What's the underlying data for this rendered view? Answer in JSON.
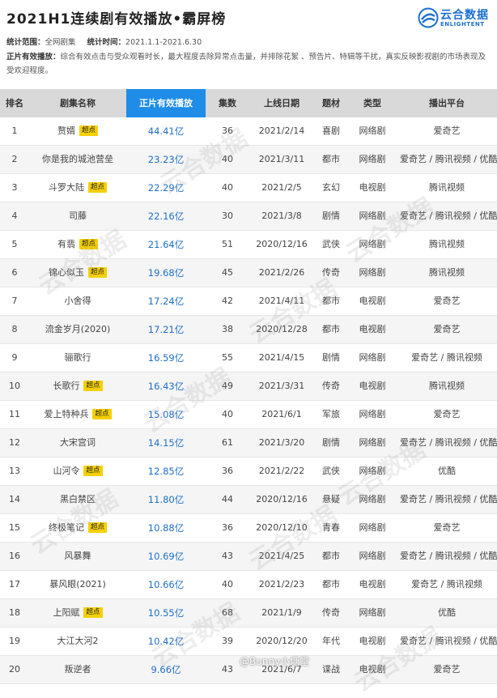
{
  "title": "2021H1连续剧有效播放•霸屏榜",
  "logo": {
    "name_cn": "云合数据",
    "name_en": "ENLIGHTENT"
  },
  "meta": {
    "scope_label": "统计范围：",
    "scope_value": "全网剧集",
    "time_label": "统计时间：",
    "time_value": "2021.1.1-2021.6.30"
  },
  "note": {
    "label": "正片有效播放：",
    "text": "综合有效点击与受众观看时长，最大程度去除异常点击量，并排除花絮 、预告片、特辑等干扰，真实反映影视剧的市场表现及受欢迎程度。"
  },
  "columns": {
    "rank": "排名",
    "name": "剧集名称",
    "plays": "正片有效播放",
    "episodes": "集数",
    "date": "上线日期",
    "genre": "题材",
    "type": "类型",
    "platform": "播出平台"
  },
  "badge_text": "超点",
  "rows": [
    {
      "rank": "1",
      "name": "赘婿",
      "badge": true,
      "plays": "44.41亿",
      "episodes": "36",
      "date": "2021/2/14",
      "genre": "喜剧",
      "type": "网络剧",
      "platform": "爱奇艺"
    },
    {
      "rank": "2",
      "name": "你是我的城池营垒",
      "badge": false,
      "plays": "23.23亿",
      "episodes": "40",
      "date": "2021/3/11",
      "genre": "都市",
      "type": "网络剧",
      "platform": "爱奇艺 / 腾讯视频 / 优酷"
    },
    {
      "rank": "3",
      "name": "斗罗大陆",
      "badge": true,
      "plays": "22.29亿",
      "episodes": "40",
      "date": "2021/2/5",
      "genre": "玄幻",
      "type": "电视剧",
      "platform": "腾讯视频"
    },
    {
      "rank": "4",
      "name": "司藤",
      "badge": false,
      "plays": "22.16亿",
      "episodes": "30",
      "date": "2021/3/8",
      "genre": "剧情",
      "type": "网络剧",
      "platform": "爱奇艺 / 腾讯视频 / 优酷"
    },
    {
      "rank": "5",
      "name": "有翡",
      "badge": true,
      "plays": "21.64亿",
      "episodes": "51",
      "date": "2020/12/16",
      "genre": "武侠",
      "type": "网络剧",
      "platform": "腾讯视频"
    },
    {
      "rank": "6",
      "name": "锦心似玉",
      "badge": true,
      "plays": "19.68亿",
      "episodes": "45",
      "date": "2021/2/26",
      "genre": "传奇",
      "type": "网络剧",
      "platform": "腾讯视频"
    },
    {
      "rank": "7",
      "name": "小舍得",
      "badge": false,
      "plays": "17.24亿",
      "episodes": "42",
      "date": "2021/4/11",
      "genre": "都市",
      "type": "电视剧",
      "platform": "爱奇艺"
    },
    {
      "rank": "8",
      "name": "流金岁月(2020)",
      "badge": false,
      "plays": "17.21亿",
      "episodes": "38",
      "date": "2020/12/28",
      "genre": "都市",
      "type": "电视剧",
      "platform": "爱奇艺"
    },
    {
      "rank": "9",
      "name": "骊歌行",
      "badge": false,
      "plays": "16.59亿",
      "episodes": "55",
      "date": "2021/4/15",
      "genre": "剧情",
      "type": "网络剧",
      "platform": "爱奇艺 / 腾讯视频"
    },
    {
      "rank": "10",
      "name": "长歌行",
      "badge": true,
      "plays": "16.43亿",
      "episodes": "49",
      "date": "2021/3/31",
      "genre": "传奇",
      "type": "电视剧",
      "platform": "腾讯视频"
    },
    {
      "rank": "11",
      "name": "爱上特种兵",
      "badge": true,
      "plays": "15.08亿",
      "episodes": "40",
      "date": "2021/6/1",
      "genre": "军旅",
      "type": "网络剧",
      "platform": "爱奇艺"
    },
    {
      "rank": "12",
      "name": "大宋宫词",
      "badge": false,
      "plays": "14.15亿",
      "episodes": "61",
      "date": "2021/3/20",
      "genre": "剧情",
      "type": "网络剧",
      "platform": "爱奇艺 / 腾讯视频 / 优酷"
    },
    {
      "rank": "13",
      "name": "山河令",
      "badge": true,
      "plays": "12.85亿",
      "episodes": "36",
      "date": "2021/2/22",
      "genre": "武侠",
      "type": "网络剧",
      "platform": "优酷"
    },
    {
      "rank": "14",
      "name": "黑白禁区",
      "badge": false,
      "plays": "11.80亿",
      "episodes": "44",
      "date": "2020/12/16",
      "genre": "悬疑",
      "type": "网络剧",
      "platform": "爱奇艺 / 腾讯视频 / 优酷"
    },
    {
      "rank": "15",
      "name": "终极笔记",
      "badge": true,
      "plays": "10.88亿",
      "episodes": "36",
      "date": "2020/12/10",
      "genre": "青春",
      "type": "网络剧",
      "platform": "爱奇艺"
    },
    {
      "rank": "16",
      "name": "风暴舞",
      "badge": false,
      "plays": "10.69亿",
      "episodes": "43",
      "date": "2021/4/25",
      "genre": "都市",
      "type": "网络剧",
      "platform": "爱奇艺 / 腾讯视频 / 优酷"
    },
    {
      "rank": "17",
      "name": "暴风眼(2021)",
      "badge": false,
      "plays": "10.66亿",
      "episodes": "40",
      "date": "2021/2/23",
      "genre": "都市",
      "type": "电视剧",
      "platform": "爱奇艺 / 腾讯视频"
    },
    {
      "rank": "18",
      "name": "上阳赋",
      "badge": true,
      "plays": "10.55亿",
      "episodes": "68",
      "date": "2021/1/9",
      "genre": "传奇",
      "type": "网络剧",
      "platform": "优酷"
    },
    {
      "rank": "19",
      "name": "大江大河2",
      "badge": false,
      "plays": "10.42亿",
      "episodes": "39",
      "date": "2020/12/20",
      "genre": "年代",
      "type": "电视剧",
      "platform": "爱奇艺 / 腾讯视频 / 优酷"
    },
    {
      "rank": "20",
      "name": "叛逆者",
      "badge": false,
      "plays": "9.66亿",
      "episodes": "43",
      "date": "2021/6/7",
      "genre": "谍战",
      "type": "电视剧",
      "platform": "爱奇艺"
    }
  ],
  "watermark": {
    "cn": "云合数据",
    "en": "ENLIGHTENT"
  },
  "weibo_credit": "@Bunny小塘堂"
}
